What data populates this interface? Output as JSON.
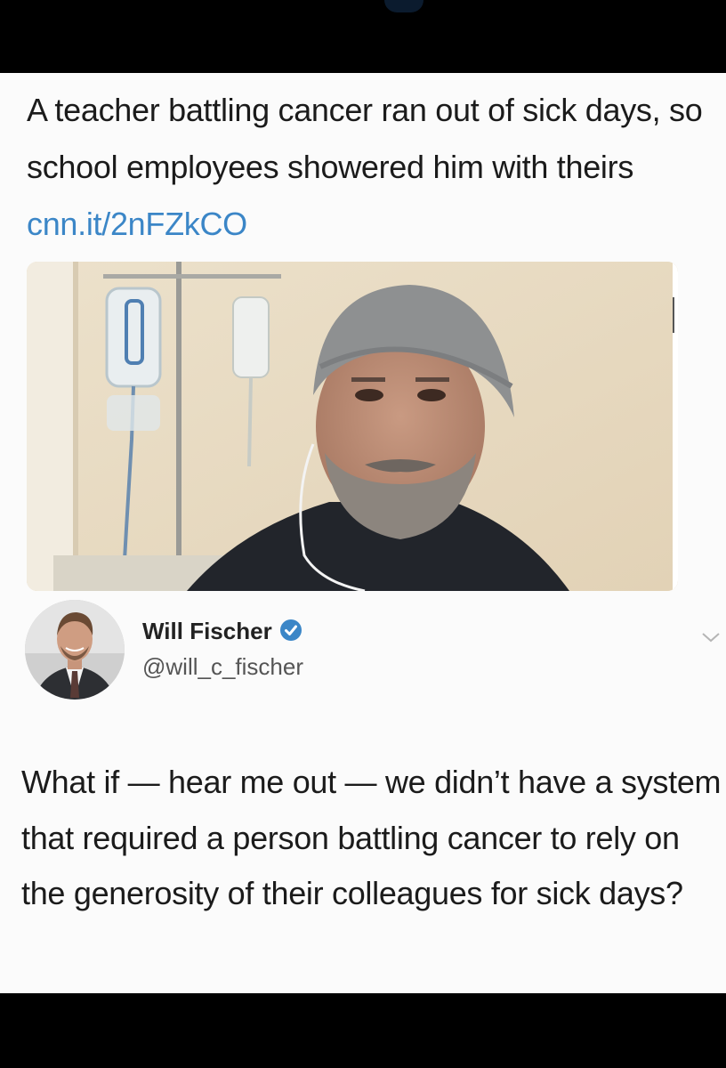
{
  "headline": {
    "text": "A teacher battling cancer ran out of sick days, so school employees showered him with theirs ",
    "link": "cnn.it/2nFZkCO"
  },
  "author": {
    "name": "Will Fischer",
    "handle": "@will_c_fischer",
    "verified": true
  },
  "tweet": {
    "text": "What if — hear me out — we didn’t have a system that required a person battling cancer to rely on the generosity of their colleagues for sick days?"
  },
  "colors": {
    "link": "#3b86c7",
    "verified_badge": "#3b86c7",
    "background": "#fbfbfb",
    "frame": "#000000"
  },
  "icons": {
    "verified": "verified-badge-icon",
    "caret": "chevron-down-icon"
  }
}
